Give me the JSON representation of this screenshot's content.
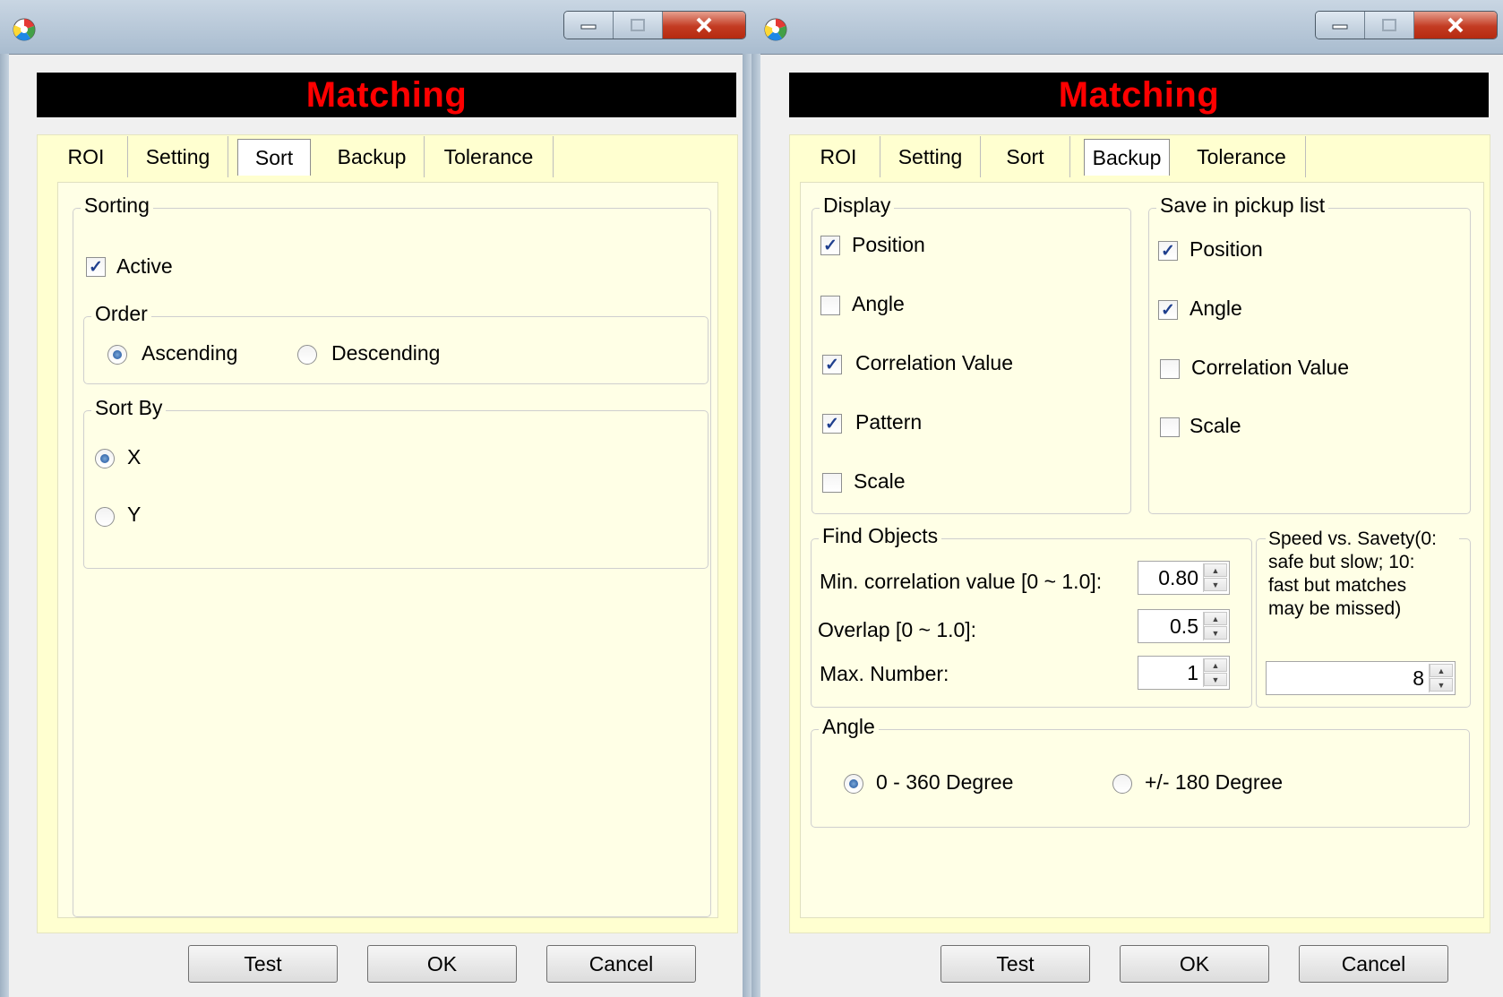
{
  "left": {
    "banner": "Matching",
    "tabs": [
      "ROI",
      "Setting",
      "Sort",
      "Backup",
      "Tolerance"
    ],
    "active_tab": "Sort",
    "sorting": {
      "legend": "Sorting",
      "active_label": "Active",
      "active_checked": true,
      "order": {
        "legend": "Order",
        "ascending": "Ascending",
        "descending": "Descending",
        "selected": "Ascending"
      },
      "sort_by": {
        "legend": "Sort By",
        "x": "X",
        "y": "Y",
        "selected": "X"
      }
    },
    "buttons": {
      "test": "Test",
      "ok": "OK",
      "cancel": "Cancel"
    }
  },
  "right": {
    "banner": "Matching",
    "tabs": [
      "ROI",
      "Setting",
      "Sort",
      "Backup",
      "Tolerance"
    ],
    "active_tab": "Backup",
    "display": {
      "legend": "Display",
      "items": [
        {
          "label": "Position",
          "checked": true
        },
        {
          "label": "Angle",
          "checked": false
        },
        {
          "label": "Correlation Value",
          "checked": true
        },
        {
          "label": "Pattern",
          "checked": true
        },
        {
          "label": "Scale",
          "checked": false
        }
      ]
    },
    "pickup": {
      "legend": "Save in pickup list",
      "items": [
        {
          "label": "Position",
          "checked": true
        },
        {
          "label": "Angle",
          "checked": true
        },
        {
          "label": "Correlation Value",
          "checked": false
        },
        {
          "label": "Scale",
          "checked": false
        }
      ]
    },
    "find": {
      "legend": "Find Objects",
      "min_corr_label": "Min. correlation value [0 ~ 1.0]:",
      "min_corr_value": "0.80",
      "overlap_label": "Overlap [0 ~ 1.0]:",
      "overlap_value": "0.5",
      "max_number_label": "Max. Number:",
      "max_number_value": "1"
    },
    "speed": {
      "legend_lines": [
        "Speed vs. Savety(0:",
        "safe but slow; 10:",
        "fast but matches",
        "may be missed)"
      ],
      "value": "8"
    },
    "angle": {
      "legend": "Angle",
      "opt1": "0 - 360 Degree",
      "opt2": "+/- 180 Degree",
      "selected": "0 - 360 Degree"
    },
    "buttons": {
      "test": "Test",
      "ok": "OK",
      "cancel": "Cancel"
    }
  },
  "icons": {
    "app": "app-logo-icon",
    "minimize": "minimize-icon",
    "maximize": "maximize-icon",
    "close": "close-icon"
  },
  "colors": {
    "banner_text": "#ff0000",
    "banner_bg": "#000000",
    "panel_bg": "#ffffd0"
  }
}
